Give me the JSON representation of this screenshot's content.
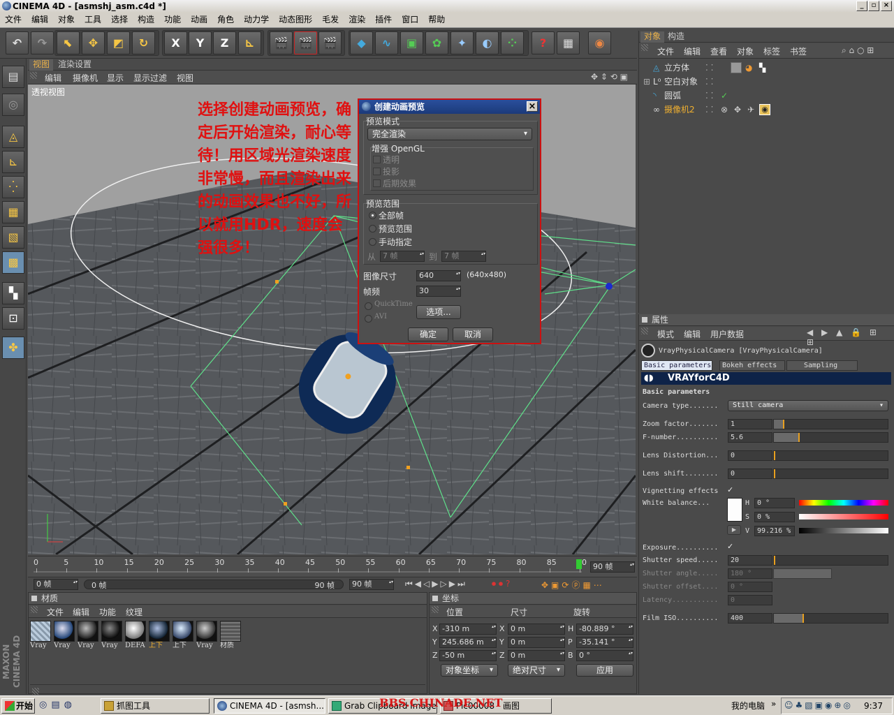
{
  "window": {
    "title": "CINEMA 4D - [asmshj_asm.c4d *]"
  },
  "menubar": [
    "文件",
    "编辑",
    "对象",
    "工具",
    "选择",
    "构造",
    "功能",
    "动画",
    "角色",
    "动力学",
    "动态图形",
    "毛发",
    "渲染",
    "插件",
    "窗口",
    "帮助"
  ],
  "toolbar": {
    "axis_x": "X",
    "axis_y": "Y",
    "axis_z": "Z",
    "help": "?"
  },
  "viewport_tabs": [
    "视图",
    "渲染设置"
  ],
  "viewport_menu": [
    "编辑",
    "摄像机",
    "显示",
    "显示过滤",
    "视图"
  ],
  "viewport_label": "透视视图",
  "annotation": "选择创建动画预览，确定后开始渲染，耐心等待！用区域光渲染速度非常慢，而且渲染出来的动画效果也不好，所以就用HDR，速度会强很多！",
  "dialog": {
    "title": "创建动画预览",
    "preview_mode_label": "预览模式",
    "preview_mode_value": "完全渲染",
    "enhance_label": "增强 OpenGL",
    "enhance_options": [
      "透明",
      "投影",
      "后期效果"
    ],
    "range_label": "预览范围",
    "range_options": [
      "全部帧",
      "预览范围",
      "手动指定"
    ],
    "from_label": "从",
    "from_value": "7 帧",
    "to_label": "到",
    "to_value": "7 帧",
    "image_size_label": "图像尺寸",
    "image_size_value": "640",
    "image_size_hint": "(640x480)",
    "fps_label": "帧频",
    "fps_value": "30",
    "format_quicktime": "QuickTime",
    "format_avi": "AVI",
    "options_button": "选项...",
    "ok_button": "确定",
    "cancel_button": "取消"
  },
  "timeline": {
    "ticks": [
      "0",
      "5",
      "10",
      "15",
      "20",
      "25",
      "30",
      "35",
      "40",
      "45",
      "50",
      "55",
      "60",
      "65",
      "70",
      "75",
      "80",
      "85",
      "90"
    ],
    "end_frame": "90 帧",
    "current_frame": "0 帧",
    "range_start": "0 帧",
    "range_end": "90 帧",
    "max_frame": "90 帧"
  },
  "materials": {
    "title": "材质",
    "menu": [
      "文件",
      "编辑",
      "功能",
      "纹理"
    ],
    "items": [
      "Vray",
      "Vray",
      "Vray",
      "Vray",
      "DEFA",
      "上下",
      "上下",
      "Vray",
      "材质"
    ]
  },
  "coords": {
    "title": "坐标",
    "headers": [
      "位置",
      "尺寸",
      "旋转"
    ],
    "rows": [
      {
        "axis": "X",
        "pos": "-310 m",
        "size_axis": "X",
        "size": "0 m",
        "rot_axis": "H",
        "rot": "-80.889 °"
      },
      {
        "axis": "Y",
        "pos": "245.686 m",
        "size_axis": "Y",
        "size": "0 m",
        "rot_axis": "P",
        "rot": "-35.141 °"
      },
      {
        "axis": "Z",
        "pos": "-50 m",
        "size_axis": "Z",
        "size": "0 m",
        "rot_axis": "B",
        "rot": "0 °"
      }
    ],
    "mode1": "对象坐标",
    "mode2": "绝对尺寸",
    "apply": "应用"
  },
  "objects": {
    "tabs": [
      "对象",
      "构造"
    ],
    "menu": [
      "文件",
      "编辑",
      "查看",
      "对象",
      "标签",
      "书签"
    ],
    "items": [
      "立方体",
      "空白对象",
      "圆弧",
      "摄像机2"
    ]
  },
  "attributes": {
    "title": "属性",
    "menu": [
      "模式",
      "编辑",
      "用户数据"
    ],
    "object_name": "VrayPhysicalCamera [VrayPhysicalCamera]",
    "tabs": [
      "Basic parameters",
      "Bokeh effects",
      "Sampling"
    ],
    "banner": "VRAYforC4D",
    "section": "Basic parameters",
    "camera_type_label": "Camera type.......",
    "camera_type_value": "Still camera",
    "zoom_label": "Zoom factor.......",
    "zoom_value": "1",
    "fnumber_label": "F-number..........",
    "fnumber_value": "5.6",
    "lens_dist_label": "Lens Distortion...",
    "lens_dist_value": "0",
    "lens_shift_label": "Lens shift........",
    "lens_shift_value": "0",
    "vignetting_label": "Vignetting effects",
    "white_balance_label": "White balance...",
    "wb_h": "0 °",
    "wb_s": "0 %",
    "wb_v": "99.216 %",
    "exposure_label": "Exposure..........",
    "shutter_speed_label": "Shutter speed.....",
    "shutter_speed_value": "20",
    "shutter_angle_label": "Shutter angle.....",
    "shutter_angle_value": "180 °",
    "shutter_offset_label": "Shutter offset....",
    "shutter_offset_value": "0 °",
    "latency_label": "Latency...........",
    "latency_value": "0",
    "film_iso_label": "Film ISO..........",
    "film_iso_value": "400"
  },
  "taskbar": {
    "start": "开始",
    "tasks": [
      "抓图工具",
      "CINEMA 4D - [asmsh...",
      "Grab Clipboard Image",
      "Pic00008 - 画图"
    ],
    "tray_label": "我的电脑",
    "clock": "9:37"
  },
  "watermark": "BBS.CHINADE.NET"
}
